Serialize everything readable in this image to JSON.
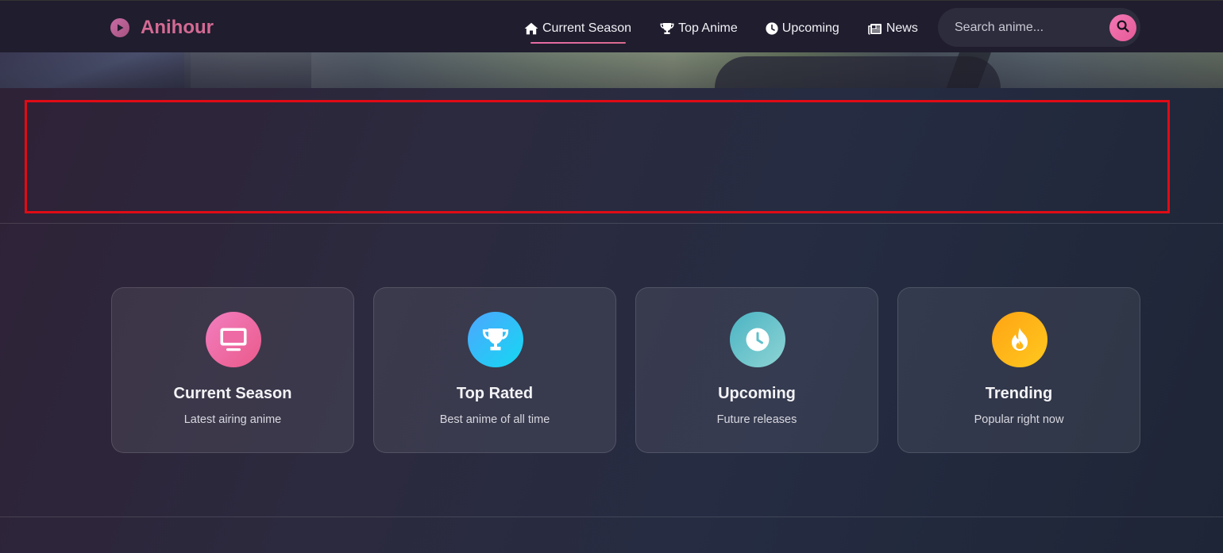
{
  "brand": {
    "name": "Anihour",
    "accent": "#d46a93"
  },
  "nav": {
    "links": [
      {
        "label": "Current Season",
        "icon": "home-icon",
        "active": true
      },
      {
        "label": "Top Anime",
        "icon": "trophy-icon",
        "active": false
      },
      {
        "label": "Upcoming",
        "icon": "clock-icon",
        "active": false
      },
      {
        "label": "News",
        "icon": "newspaper-icon",
        "active": false
      }
    ],
    "search": {
      "placeholder": "Search anime...",
      "icon": "search-icon"
    }
  },
  "highlight": {
    "color": "#e00b15"
  },
  "cards": [
    {
      "title": "Current Season",
      "subtitle": "Latest airing anime",
      "icon": "tv-icon",
      "gradient": [
        "#f27ec0",
        "#ea5a8a"
      ]
    },
    {
      "title": "Top Rated",
      "subtitle": "Best anime of all time",
      "icon": "trophy-icon",
      "gradient": [
        "#4ea6ff",
        "#14d8f2"
      ]
    },
    {
      "title": "Upcoming",
      "subtitle": "Future releases",
      "icon": "clock-icon",
      "gradient": [
        "#4bb4c4",
        "#8ed4d4"
      ]
    },
    {
      "title": "Trending",
      "subtitle": "Popular right now",
      "icon": "fire-icon",
      "gradient": [
        "#ffa414",
        "#ffc81e"
      ]
    }
  ]
}
